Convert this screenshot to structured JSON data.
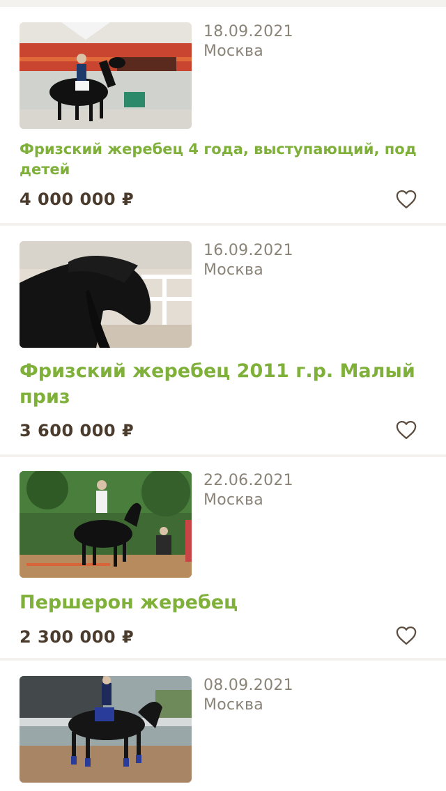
{
  "listings": [
    {
      "date": "18.09.2021",
      "city": "Москва",
      "title": "Фризский жеребец 4 года, выступающий, под детей",
      "price": "4 000 000 ₽"
    },
    {
      "date": "16.09.2021",
      "city": "Москва",
      "title": "Фризский жеребец 2011 г.р. Малый приз",
      "price": "3 600 000 ₽"
    },
    {
      "date": "22.06.2021",
      "city": "Москва",
      "title": "Першерон жеребец",
      "price": "2 300 000 ₽"
    },
    {
      "date": "08.09.2021",
      "city": "Москва"
    }
  ],
  "colors": {
    "title": "#7fb03a",
    "price": "#4a3b2c",
    "meta": "#8a8378",
    "background": "#f3f2ef"
  },
  "icons": {
    "favorite": "heart-outline-icon"
  }
}
